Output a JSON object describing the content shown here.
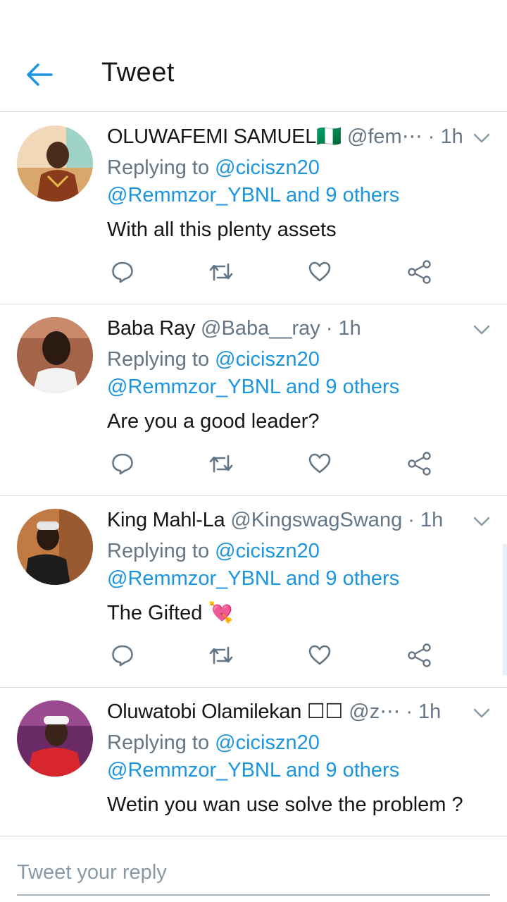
{
  "header": {
    "title": "Tweet"
  },
  "tweets": [
    {
      "name": "OLUWAFEMI SAMUEL🇳🇬",
      "handle": "@fem⋯",
      "time": "1h",
      "replying_prefix": "Replying to",
      "replying_to": "@ciciszn20",
      "mention": "@Remmzor_YBNL",
      "and_others": "and 9 others",
      "text": "With all this plenty assets",
      "avatar_colors": [
        "#e9c9a6",
        "#8a3b1c",
        "#3b2416"
      ]
    },
    {
      "name": "Baba Ray",
      "handle": "@Baba__ray",
      "time": "1h",
      "replying_prefix": "Replying to",
      "replying_to": "@ciciszn20",
      "mention": "@Remmzor_YBNL",
      "and_others": "and 9 others",
      "text": "Are you a good leader?",
      "avatar_colors": [
        "#9b5a44",
        "#f2f2f2",
        "#1e1410"
      ]
    },
    {
      "name": "King Mahl-La",
      "handle": "@KingswagSwang",
      "time": "1h",
      "replying_prefix": "Replying to",
      "replying_to": "@ciciszn20",
      "mention": "@Remmzor_YBNL",
      "and_others": "and 9 others",
      "text": "The Gifted 💘",
      "avatar_colors": [
        "#b06a3a",
        "#2a1a12",
        "#e6e6e6"
      ]
    },
    {
      "name": "Oluwatobi Olamilekan ☐☐",
      "handle": "@z⋯",
      "time": "1h",
      "replying_prefix": "Replying to",
      "replying_to": "@ciciszn20",
      "mention": "@Remmzor_YBNL",
      "and_others": "and 9 others",
      "text": "Wetin you wan use solve the problem ?",
      "avatar_colors": [
        "#7a2a6e",
        "#d8262e",
        "#f5f5f5"
      ]
    }
  ],
  "compose": {
    "placeholder": "Tweet your reply"
  },
  "colors": {
    "accent": "#1b95e0",
    "secondary_text": "#657786",
    "icon": "#657786",
    "divider": "#d8dde1"
  },
  "icons": {
    "back": "arrow-left-icon",
    "caret": "chevron-down-icon",
    "reply": "reply-icon",
    "retweet": "retweet-icon",
    "like": "heart-icon",
    "share": "share-icon"
  }
}
